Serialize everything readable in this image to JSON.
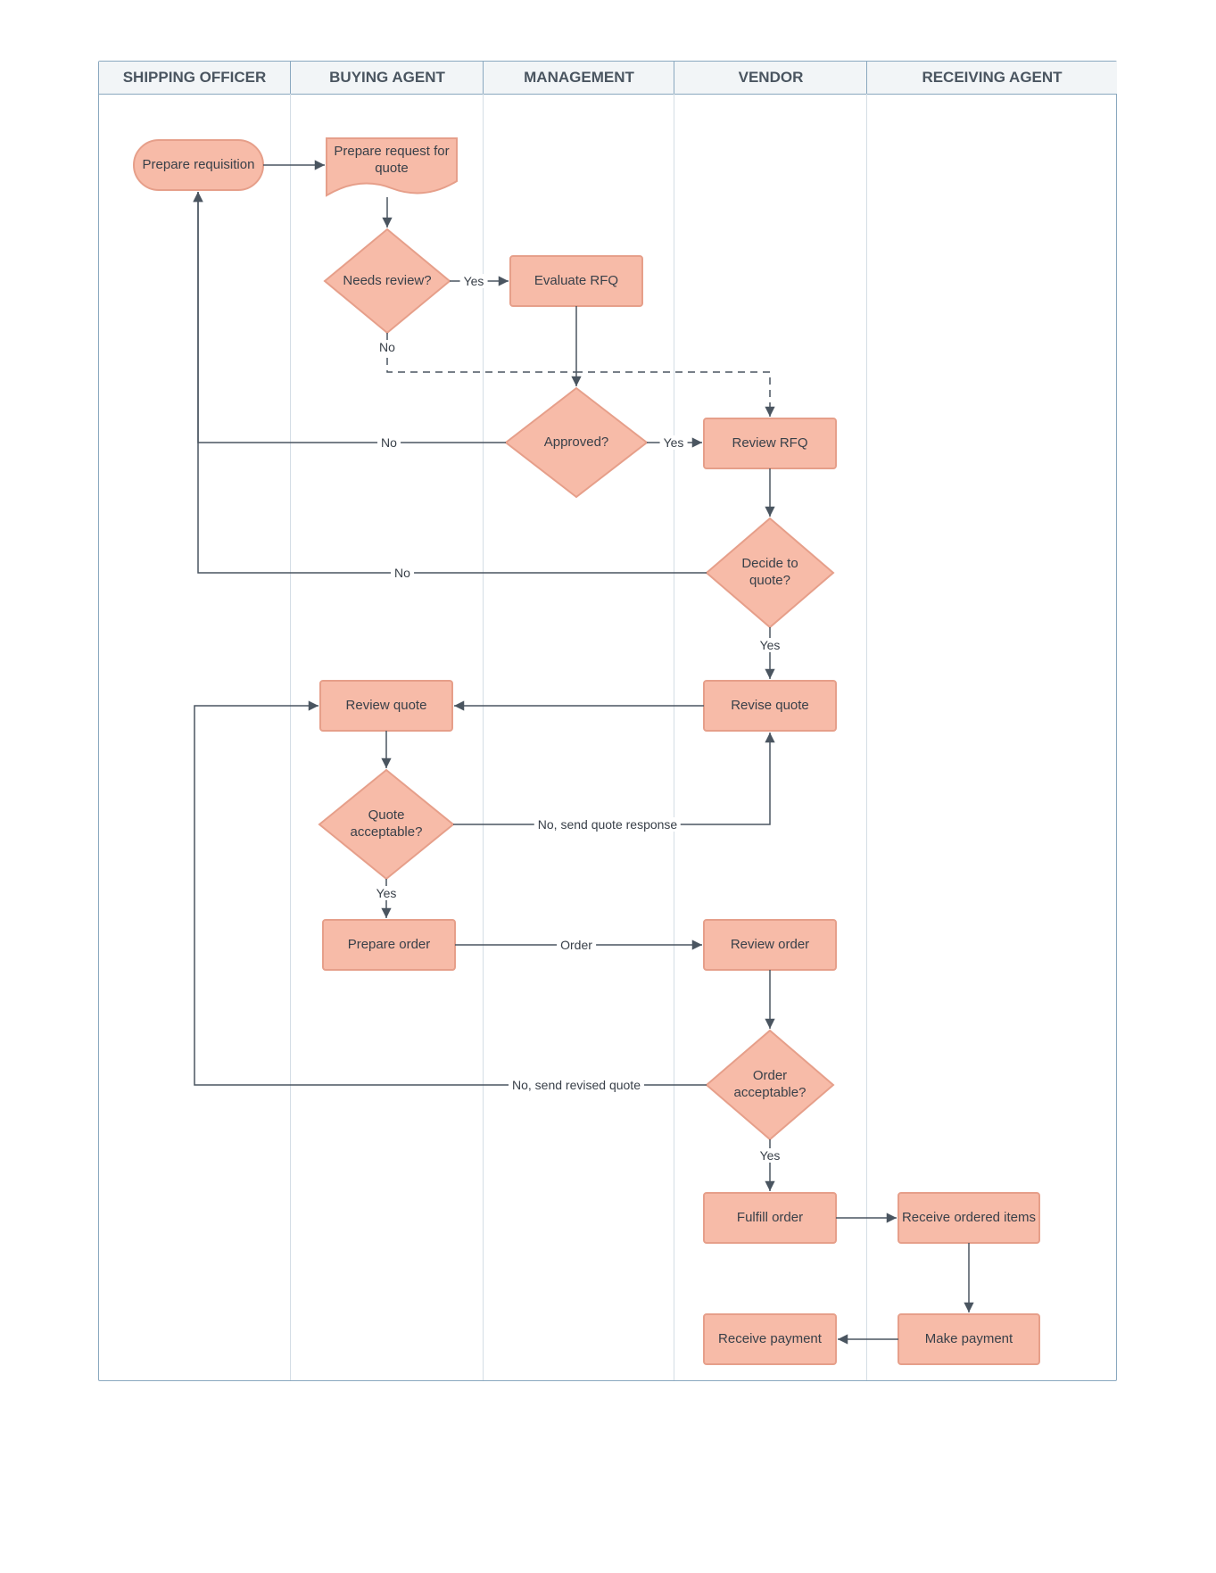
{
  "lanes": [
    {
      "id": "shipping_officer",
      "title": "SHIPPING OFFICER"
    },
    {
      "id": "buying_agent",
      "title": "BUYING AGENT"
    },
    {
      "id": "management",
      "title": "MANAGEMENT"
    },
    {
      "id": "vendor",
      "title": "VENDOR"
    },
    {
      "id": "receiving_agent",
      "title": "RECEIVING AGENT"
    }
  ],
  "nodes": {
    "prepare_requisition": "Prepare requisition",
    "prepare_rfq": "Prepare request for quote",
    "needs_review": "Needs review?",
    "evaluate_rfq": "Evaluate RFQ",
    "approved": "Approved?",
    "review_rfq": "Review RFQ",
    "decide_to_quote": "Decide to quote?",
    "revise_quote": "Revise quote",
    "review_quote": "Review quote",
    "quote_acceptable": "Quote acceptable?",
    "prepare_order": "Prepare order",
    "review_order": "Review order",
    "order_acceptable": "Order acceptable?",
    "fulfill_order": "Fulfill order",
    "receive_items": "Receive ordered items",
    "make_payment": "Make payment",
    "receive_payment": "Receive payment"
  },
  "edge_labels": {
    "needs_review_yes": "Yes",
    "needs_review_no": "No",
    "approved_yes": "Yes",
    "approved_no": "No",
    "decide_no": "No",
    "decide_yes": "Yes",
    "quote_yes": "Yes",
    "quote_no": "No, send quote response",
    "order_label": "Order",
    "order_no": "No, send revised quote",
    "order_yes": "Yes"
  },
  "style": {
    "node_fill": "#f7bba8",
    "node_stroke": "#e69f8a",
    "line_stroke": "#4a5560"
  }
}
